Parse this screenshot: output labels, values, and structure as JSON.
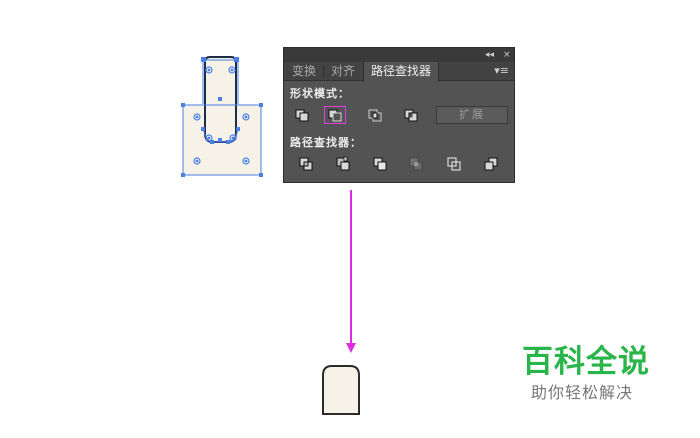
{
  "panel": {
    "collapse_glyph": "◂◂",
    "close_glyph": "×",
    "menu_glyph": "▾≡",
    "tabs": [
      {
        "label": "变换",
        "active": false
      },
      {
        "label": "对齐",
        "active": false
      },
      {
        "label": "路径查找器",
        "active": true
      }
    ],
    "shape_modes_label": "形状模式：",
    "shape_mode_buttons": [
      "unite-icon",
      "minus-front-icon",
      "intersect-icon",
      "exclude-icon"
    ],
    "highlighted_button": "minus-front-icon",
    "expand_label": "扩展",
    "pathfinders_label": "路径查找器：",
    "pathfinder_buttons": [
      "divide-icon",
      "trim-icon",
      "merge-icon",
      "crop-icon",
      "outline-icon",
      "minus-back-icon"
    ]
  },
  "colors": {
    "selection": "#4a7fe6",
    "shape_fill": "#f6f2e7",
    "arrow": "#dd2de0",
    "highlight": "#e040e0",
    "watermark_green": "#2ab54a"
  },
  "watermark": {
    "title": "百科全说",
    "subtitle": "助你轻松解决"
  }
}
